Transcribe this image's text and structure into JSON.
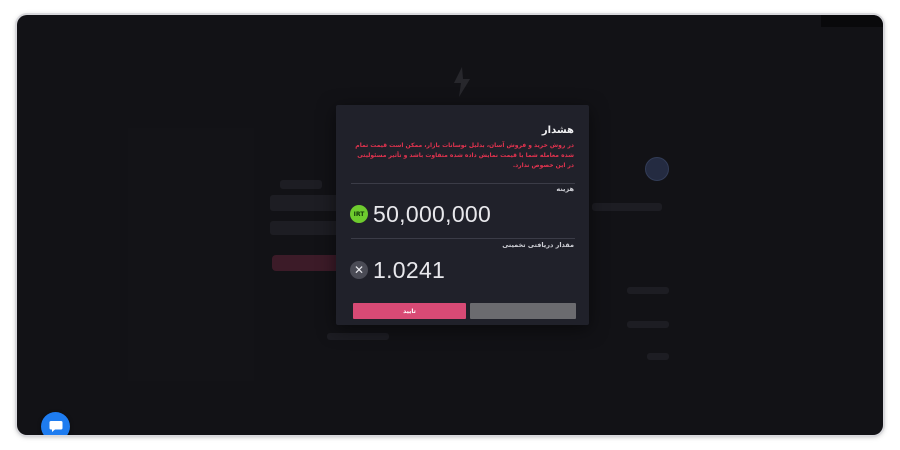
{
  "modal": {
    "title": "هشدار",
    "warning": "در روش خرید و فروش آسان، بدلیل نوسانات بازار، ممکن است قیمت تمام شده معامله شما با قیمت نمایش داده شده متفاوت باشد و تأثیر مسئولیتی در این خصوص ندارد.",
    "cost_label": "هزینه",
    "cost_currency": "IRT",
    "cost_value": "50,000,000",
    "receive_label": "مقدار دریافتی تخمینی",
    "receive_value": "1.0241",
    "receive_icon": "x-token-icon",
    "confirm_label": "تایید",
    "cancel_label": "",
    "accent_color": "#d84a75",
    "warning_color": "#e3334f"
  },
  "chat": {
    "icon": "chat-bubble-icon",
    "color": "#1e7cf0"
  }
}
